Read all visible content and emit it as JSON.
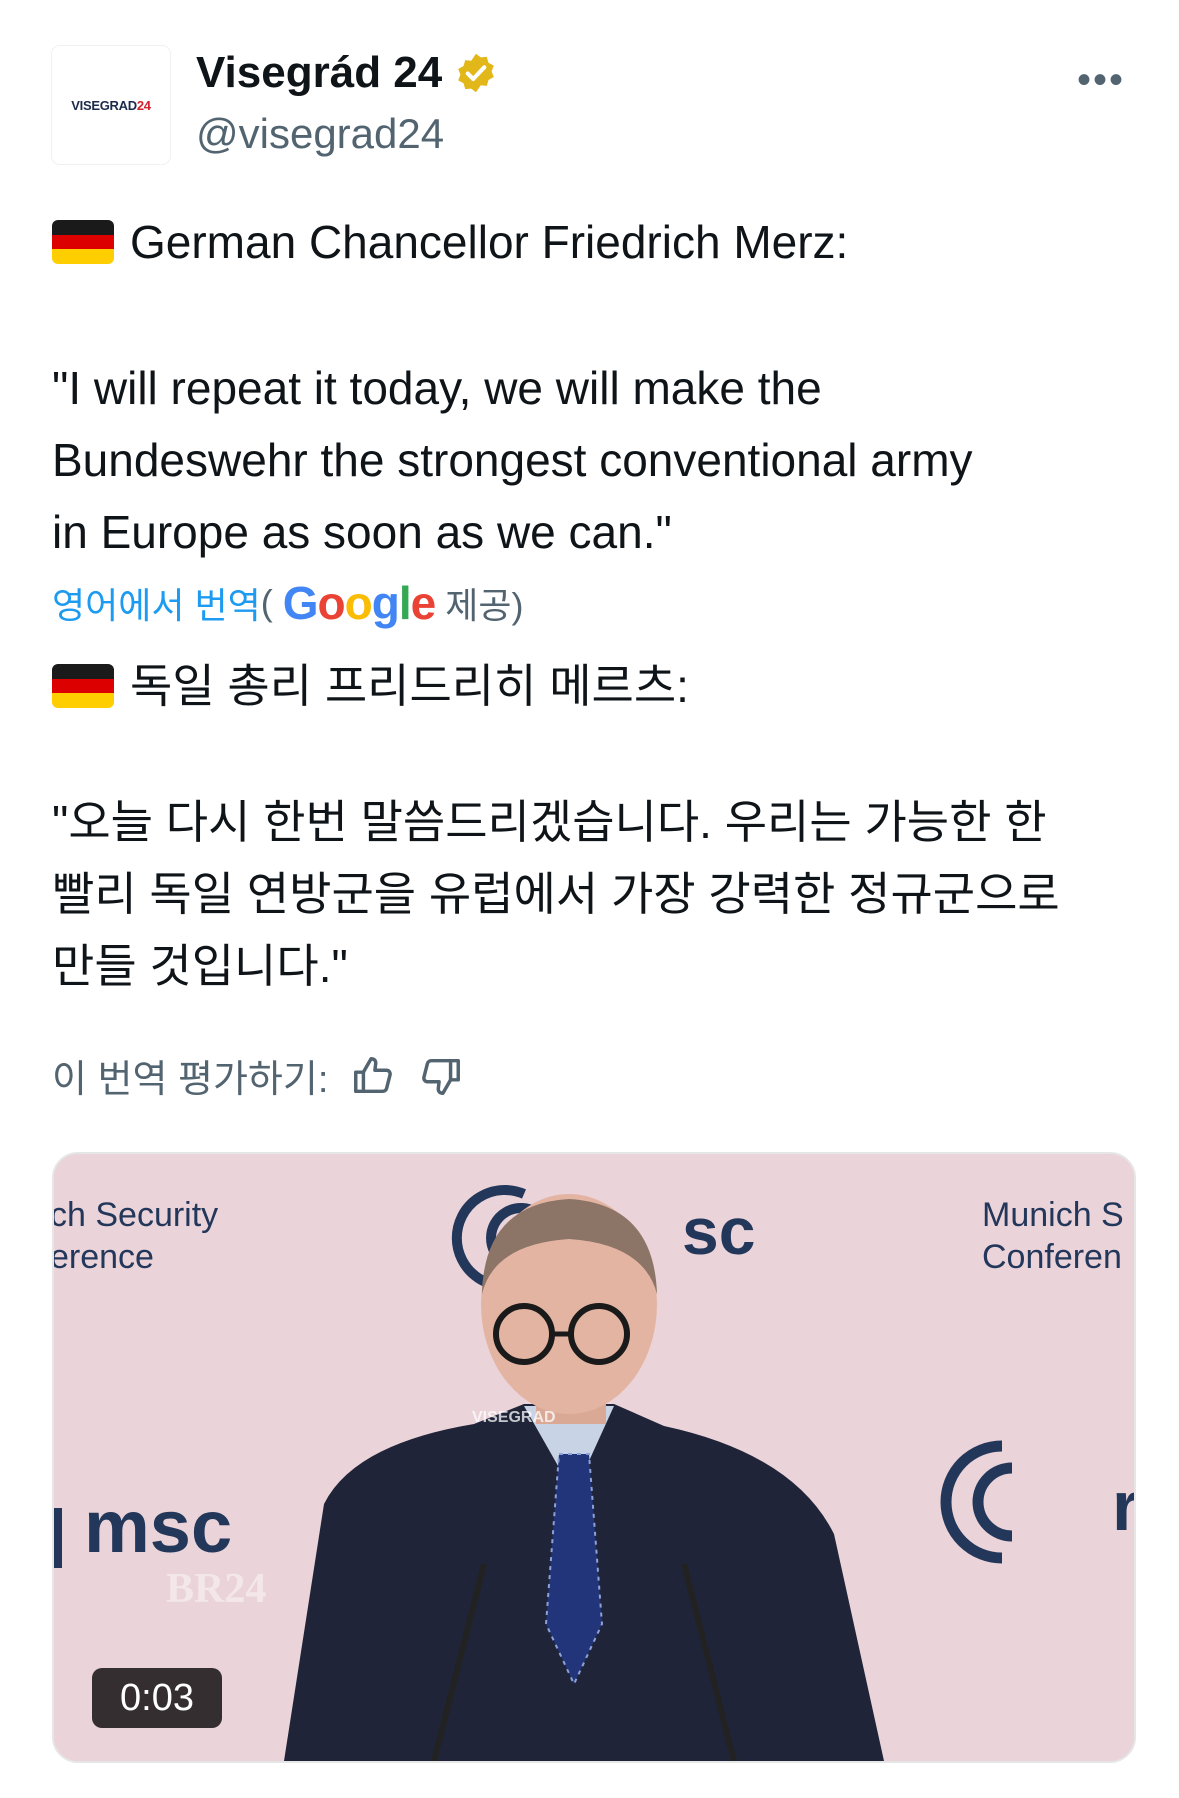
{
  "post": {
    "display_name": "Visegrád 24",
    "handle": "@visegrad24",
    "avatar_text": "VISEGRAD",
    "avatar_num": "24",
    "more_label": "•••",
    "verified_color": "#e2b719",
    "original": {
      "headline": "German Chancellor Friedrich Merz:",
      "quote_lines": [
        "\"I will repeat it today, we will make the",
        "Bundeswehr the strongest conventional army",
        "in Europe as soon as we can.\""
      ]
    },
    "translation": {
      "source_label": "영어에서 번역",
      "paren_open": "(",
      "google_label": "Google",
      "provided_label": "제공)",
      "headline": "독일 총리 프리드리히 메르츠:",
      "quote_lines": [
        "\"오늘 다시 한번 말씀드리겠습니다. 우리는 가능한 한",
        "빨리 독일 연방군을 유럽에서 가장 강력한 정규군으로",
        "만들 것입니다.\""
      ]
    },
    "rating": {
      "label": "이 번역 평가하기:"
    },
    "video": {
      "timestamp": "0:03",
      "overlay_texts": {
        "left_sign_line1": "ch Security",
        "left_sign_line2": "erence",
        "right_sign_line1": "Munich S",
        "right_sign_line2": "Conferen",
        "logo_msc": "msc",
        "logo_top": "sc",
        "logo_right": "r",
        "watermark": "VISEGRAD",
        "channel": "BR24"
      }
    }
  }
}
